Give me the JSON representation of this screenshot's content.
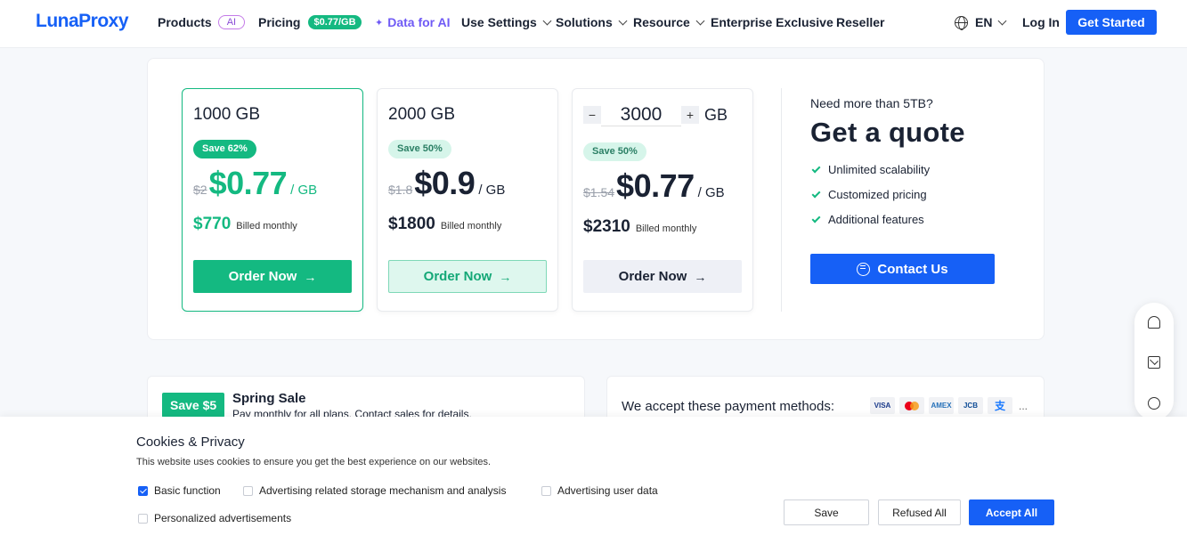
{
  "nav": {
    "logo": "LunaProxy",
    "products": "Products",
    "ai_badge": "AI",
    "pricing": "Pricing",
    "pricing_badge": "$0.77/GB",
    "data_for_ai": "Data for AI",
    "use_settings": "Use Settings",
    "solutions": "Solutions",
    "resource": "Resource",
    "enterprise": "Enterprise Exclusive",
    "reseller": "Reseller",
    "language": "EN",
    "login": "Log In",
    "get_started": "Get Started"
  },
  "plans": [
    {
      "title": "1000 GB",
      "save": "Save 62%",
      "old_price": "$2",
      "price": "$0.77",
      "unit": "/ GB",
      "total": "$770",
      "billed": "Billed monthly",
      "order": "Order Now"
    },
    {
      "title": "2000 GB",
      "save": "Save 50%",
      "old_price": "$1.8",
      "price": "$0.9",
      "unit": "/ GB",
      "total": "$1800",
      "billed": "Billed monthly",
      "order": "Order Now"
    },
    {
      "quantity": "3000",
      "minus": "−",
      "plus": "+",
      "qty_unit": "GB",
      "save": "Save 50%",
      "old_price": "$1.54",
      "price": "$0.77",
      "unit": "/ GB",
      "total": "$2310",
      "billed": "Billed monthly",
      "order": "Order Now"
    }
  ],
  "quote": {
    "question": "Need more than 5TB?",
    "title": "Get a quote",
    "features": [
      "Unlimited scalability",
      "Customized pricing",
      "Additional features"
    ],
    "contact": "Contact Us"
  },
  "sale": {
    "badge": "Save $5",
    "title": "Spring Sale",
    "subtitle": "Pay monthly for all plans. Contact sales for details."
  },
  "payment": {
    "label": "We accept these payment methods:",
    "methods": [
      "VISA",
      "mastercard",
      "AMEX",
      "JCB",
      "alipay"
    ],
    "more": "..."
  },
  "cookies": {
    "title": "Cookies & Privacy",
    "description": "This website uses cookies to ensure you get the best experience on our websites.",
    "options": [
      {
        "label": "Basic function",
        "checked": true
      },
      {
        "label": "Advertising related storage mechanism and analysis",
        "checked": false
      },
      {
        "label": "Advertising user data",
        "checked": false
      },
      {
        "label": "Personalized advertisements",
        "checked": false
      }
    ],
    "save": "Save",
    "refuse": "Refused All",
    "accept": "Accept All"
  },
  "colors": {
    "brand": "#1660f6",
    "green": "#14b981"
  }
}
